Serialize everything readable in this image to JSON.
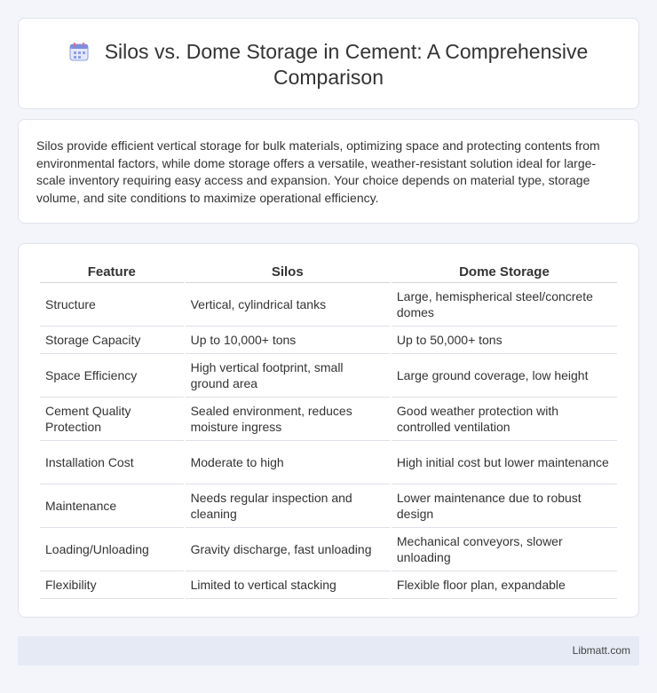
{
  "header": {
    "title": "Silos vs. Dome Storage in Cement: A Comprehensive Comparison",
    "icon": "calendar-icon"
  },
  "intro": {
    "text": "Silos provide efficient vertical storage for bulk materials, optimizing space and protecting contents from environmental factors, while dome storage offers a versatile, weather-resistant solution ideal for large-scale inventory requiring easy access and expansion. Your choice depends on material type, storage volume, and site conditions to maximize operational efficiency."
  },
  "table": {
    "headers": [
      "Feature",
      "Silos",
      "Dome Storage"
    ],
    "rows": [
      [
        "Structure",
        "Vertical, cylindrical tanks",
        "Large, hemispherical steel/concrete domes"
      ],
      [
        "Storage Capacity",
        "Up to 10,000+ tons",
        "Up to 50,000+ tons"
      ],
      [
        "Space Efficiency",
        "High vertical footprint, small ground area",
        "Large ground coverage, low height"
      ],
      [
        "Cement Quality Protection",
        "Sealed environment, reduces moisture ingress",
        "Good weather protection with controlled ventilation"
      ],
      [
        "Installation Cost",
        "Moderate to high",
        "High initial cost but lower maintenance"
      ],
      [
        "Maintenance",
        "Needs regular inspection and cleaning",
        "Lower maintenance due to robust design"
      ],
      [
        "Loading/Unloading",
        "Gravity discharge, fast unloading",
        "Mechanical conveyors, slower unloading"
      ],
      [
        "Flexibility",
        "Limited to vertical stacking",
        "Flexible floor plan, expandable"
      ]
    ]
  },
  "footer": {
    "text": "Libmatt.com"
  },
  "colors": {
    "background": "#f3f5fa",
    "card": "#ffffff",
    "footer": "#e6eaf5",
    "icon_accent": "#7b8fe0"
  }
}
